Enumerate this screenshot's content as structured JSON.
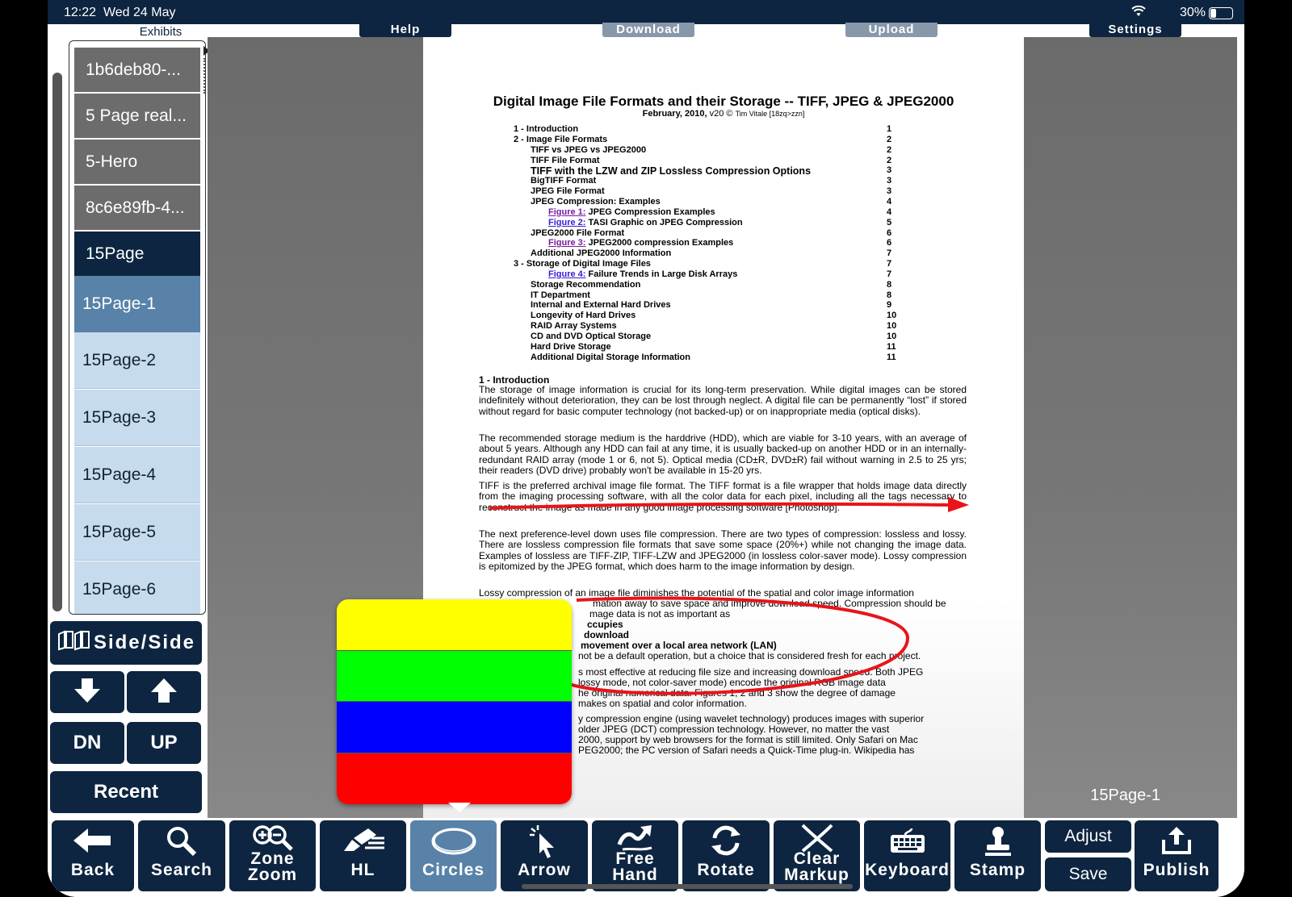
{
  "status": {
    "time": "12:22",
    "date": "Wed 24 May",
    "battery": "30%"
  },
  "topbar": {
    "help": "Help",
    "download": "Download",
    "upload": "Upload",
    "settings": "Settings"
  },
  "exhibits": {
    "label": "Exhibits",
    "items": [
      "1b6deb80-...",
      "5 Page real...",
      "5-Hero",
      "8c6e89fb-4...",
      "15Page",
      "15Page-1",
      "15Page-2",
      "15Page-3",
      "15Page-4",
      "15Page-5",
      "15Page-6"
    ]
  },
  "sidebuttons": {
    "side_side": "Side/Side",
    "dn": "DN",
    "up": "UP",
    "recent": "Recent"
  },
  "document": {
    "title": "Digital Image File Formats and their Storage -- TIFF, JPEG & JPEG2000",
    "subtitle_date": "February, 2010,",
    "subtitle_ver": "v20 ©",
    "subtitle_author": "Tim Vitale [18zq>zzn]",
    "toc": [
      {
        "text": "1 - Introduction",
        "page": "1",
        "level": 0
      },
      {
        "text": "2 - Image File Formats",
        "page": "2",
        "level": 0
      },
      {
        "text": "TIFF vs JPEG vs JPEG2000",
        "page": "2",
        "level": 1
      },
      {
        "text": "TIFF File Format",
        "page": "2",
        "level": 1
      },
      {
        "text": "TIFF with the LZW and ZIP Lossless Compression Options",
        "page": "3",
        "level": 1,
        "big": true
      },
      {
        "text": "BigTIFF Format",
        "page": "3",
        "level": 1
      },
      {
        "text": "JPEG File Format",
        "page": "3",
        "level": 1
      },
      {
        "text": "JPEG Compression: Examples",
        "page": "4",
        "level": 1
      },
      {
        "fig": "Figure 1:",
        "text": "JPEG Compression Examples",
        "page": "4",
        "level": 2,
        "purple": true
      },
      {
        "fig": "Figure 2:",
        "text": "TASI Graphic on JPEG Compression",
        "page": "5",
        "level": 2
      },
      {
        "text": "JPEG2000 File Format",
        "page": "6",
        "level": 1
      },
      {
        "fig": "Figure 3:",
        "text": "JPEG2000 compression Examples",
        "page": "6",
        "level": 2,
        "purple": true
      },
      {
        "text": "Additional JPEG2000 Information",
        "page": "7",
        "level": 1
      },
      {
        "text": "3 - Storage of Digital Image Files",
        "page": "7",
        "level": 0
      },
      {
        "fig": "Figure 4:",
        "text": "Failure Trends in Large Disk Arrays",
        "page": "7",
        "level": 2
      },
      {
        "text": "Storage Recommendation",
        "page": "8",
        "level": 1
      },
      {
        "text": "IT Department",
        "page": "8",
        "level": 1
      },
      {
        "text": "Internal and External Hard Drives",
        "page": "9",
        "level": 1
      },
      {
        "text": "Longevity of Hard Drives",
        "page": "10",
        "level": 1
      },
      {
        "text": "RAID Array Systems",
        "page": "10",
        "level": 1
      },
      {
        "text": "CD and DVD Optical Storage",
        "page": "10",
        "level": 1
      },
      {
        "text": "Hard Drive Storage",
        "page": "11",
        "level": 1
      },
      {
        "text": "Additional Digital Storage Information",
        "page": "11",
        "level": 1
      }
    ],
    "intro_heading": "1 - Introduction",
    "p1": "The storage of image information is crucial for its long-term preservation. While digital images can be stored indefinitely without deterioration, they can be lost through neglect. A digital file can be permanently “lost” if stored without regard for basic computer technology (not backed-up) or on inappropriate media (optical disks).",
    "p2": "The recommended storage medium is the harddrive (HDD), which are viable for 3-10 years, with an average of about 5 years. Although any HDD can fail at any time, it is usually backed-up on another HDD or in an internally-redundant RAID array (mode 1 or 6, not 5). Optical media (CD±R, DVD±R) fail without warning in 2.5 to 25 yrs; their readers (DVD drive) probably won't be available in 15-20 yrs.",
    "p3": "TIFF is the preferred archival image file format. The TIFF format is a file wrapper that holds image data directly from the imaging processing software, with all the color data for each pixel, including all the tags necessary to reconstruct the image as made in any good image processing software [Photoshop].",
    "p4": "The next preference-level down uses file compression. There are two types of compression: lossless and lossy. There are lossless compression file formats that save some space (20%+) while not changing the image data. Examples of lossless are TIFF-ZIP, TIFF-LZW and JPEG2000 (in lossless color-saver mode). Lossy compression is epitomized by the JPEG format, which does harm to the image information by design.",
    "p5a": "Lossy compression of an image file diminishes the potential of the spatial and color image information",
    "p5b": "mation away to save space and improve download speed. Compression should be",
    "p5c": "mage data is not as important as",
    "p5d": "ccupies",
    "p5e": "download",
    "p5f": "movement over a local area network (LAN)",
    "p5g": "not be a default operation, but a choice that is considered fresh for each project.",
    "p6a": "s most effective at reducing file size and increasing download speed. Both JPEG",
    "p6b": "lossy mode, not color-saver mode) encode the original RGB image data",
    "p6c": "he original numerical data. Figures 1, 2 and 3 show the degree of damage",
    "p6d": "makes on spatial and color information.",
    "p7a": "y compression engine (using wavelet technology) produces images with superior",
    "p7b": "older JPEG (DCT) compression technology. However, no matter the vast",
    "p7c": "2000, support by web browsers for the format is still limited. Only Safari on Mac",
    "p7d": "PEG2000; the PC version of Safari needs a Quick-Time plug-in. Wikipedia has"
  },
  "page_label": "15Page-1",
  "color_palette": [
    "#ffff00",
    "#00ff00",
    "#0000ff",
    "#ff0000"
  ],
  "markup_color": "#e8141a",
  "toolbar": {
    "back": "Back",
    "search": "Search",
    "zone_zoom_1": "Zone",
    "zone_zoom_2": "Zoom",
    "hl": "HL",
    "circles": "Circles",
    "arrow": "Arrow",
    "freehand_1": "Free",
    "freehand_2": "Hand",
    "rotate": "Rotate",
    "clear_1": "Clear",
    "clear_2": "Markup",
    "keyboard": "Keyboard",
    "stamp": "Stamp",
    "adjust": "Adjust",
    "save": "Save",
    "publish": "Publish"
  },
  "colors": {
    "navy": "#0d2540",
    "selected_tool": "#5882a8",
    "list_light": "#c6dbee"
  }
}
